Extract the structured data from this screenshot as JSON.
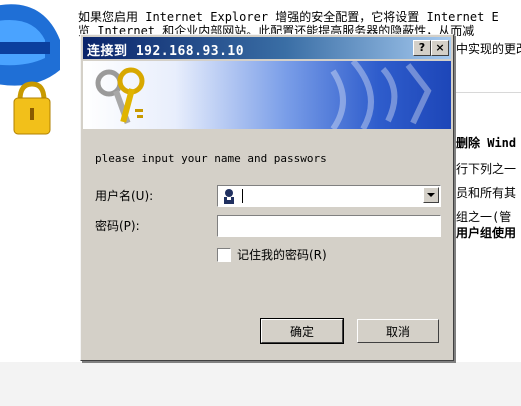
{
  "background": {
    "lines": [
      "如果您启用 Internet Explorer 增强的安全配置，它将设置 Internet E",
      "览 Internet 和企业内部网站。此配置还能提高服务器的隐蔽性，从而减"
    ],
    "right_fragments": [
      "中实现的更改",
      "删除 Wind",
      "行下列之一",
      "员和所有其",
      "组之一(管",
      "用户组使用"
    ]
  },
  "dialog": {
    "title": "连接到 192.168.93.10",
    "help_button": "?",
    "close_button": "×",
    "prompt": "please input your name and passwors",
    "username_label": "用户名(U):",
    "username_value": "",
    "password_label": "密码(P):",
    "password_value": "",
    "remember_label": "记住我的密码(R)",
    "remember_checked": false,
    "ok_button": "确定",
    "cancel_button": "取消"
  }
}
